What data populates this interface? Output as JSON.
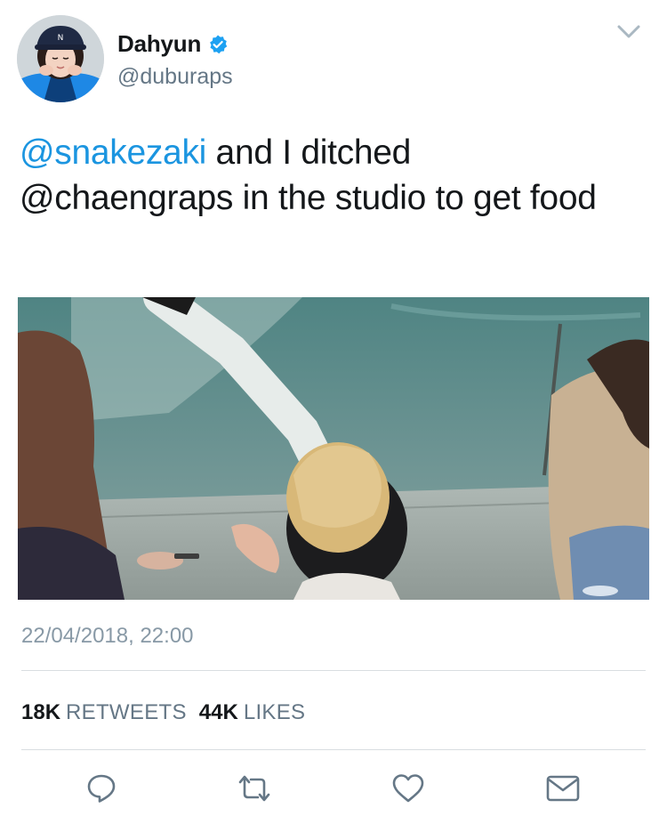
{
  "tweet": {
    "display_name": "Dahyun",
    "handle": "@duburaps",
    "text": {
      "mention_1": "@snakezaki",
      "middle_1": " and I ditched",
      "line_2": "@chaengraps in the studio to get food"
    },
    "timestamp": "22/04/2018, 22:00",
    "retweets_count": "18K",
    "retweets_label": "RETWEETS",
    "likes_count": "44K",
    "likes_label": "LIKES"
  },
  "colors": {
    "mention": "#1b95e0",
    "verified": "#1da1f2",
    "secondary_text": "#657786",
    "icon": "#657786"
  },
  "icons": {
    "menu": "chevron-down-icon",
    "verified": "verified-badge-icon",
    "reply": "reply-icon",
    "retweet": "retweet-icon",
    "like": "heart-icon",
    "share": "envelope-icon"
  }
}
